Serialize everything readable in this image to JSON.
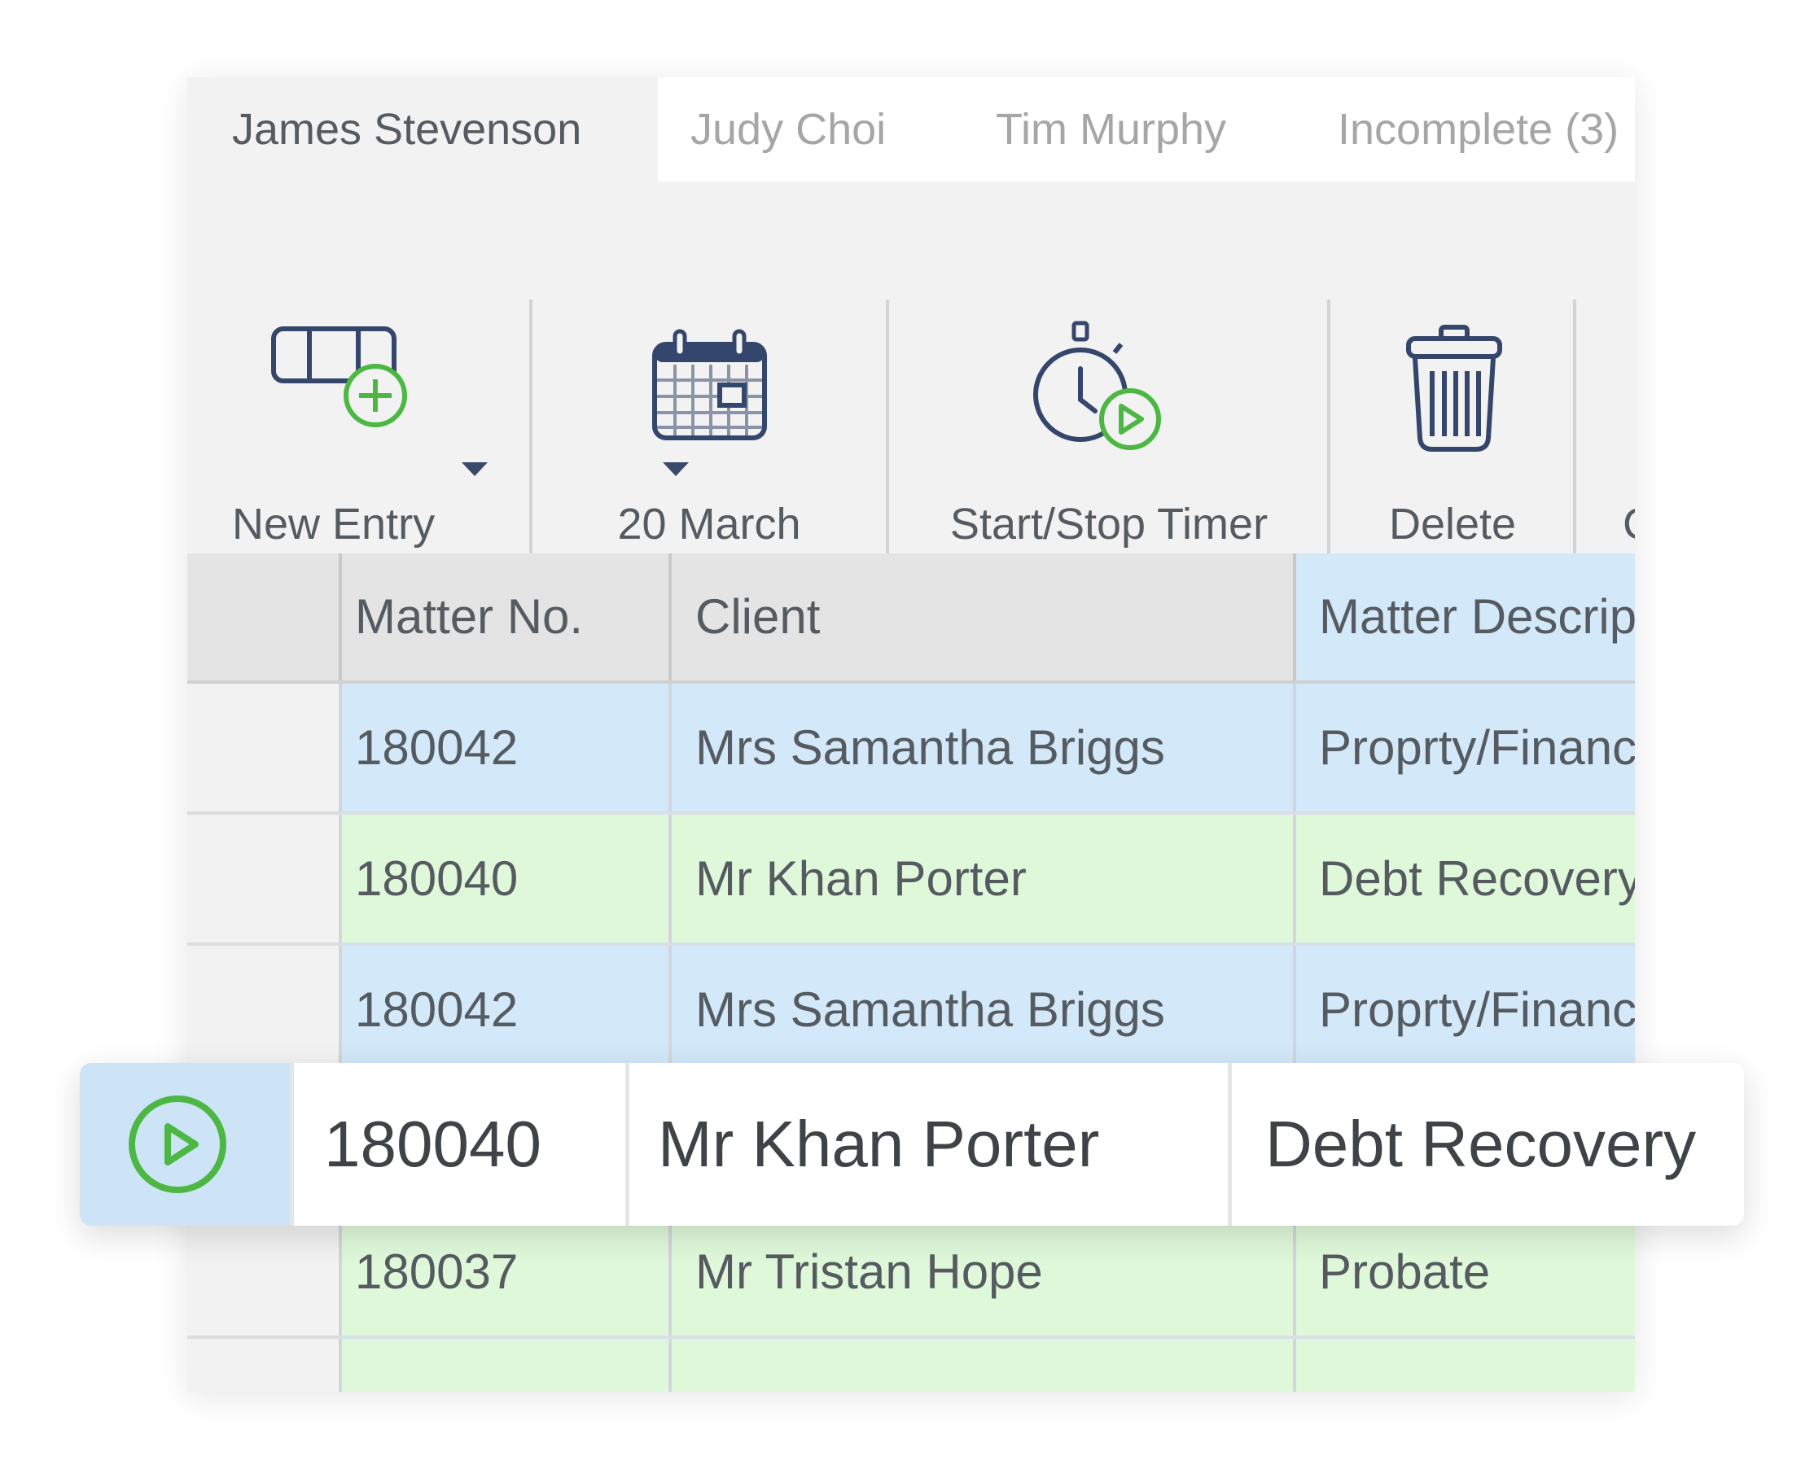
{
  "tabs": [
    {
      "label": "James Stevenson",
      "active": true
    },
    {
      "label": "Judy Choi",
      "active": false
    },
    {
      "label": "Tim Murphy",
      "active": false
    },
    {
      "label": "Incomplete (3)",
      "active": false
    }
  ],
  "toolbar": {
    "new_entry": {
      "label": "New Entry",
      "icon": "new-entry-icon",
      "has_dropdown": true
    },
    "date": {
      "label": "20 March",
      "icon": "calendar-icon",
      "has_dropdown": true
    },
    "timer": {
      "label": "Start/Stop Timer",
      "icon": "stopwatch-play-icon"
    },
    "delete": {
      "label": "Delete",
      "icon": "trash-icon"
    },
    "cut_off_label": "C"
  },
  "table": {
    "columns": [
      "Matter No.",
      "Client",
      "Matter Descrip"
    ],
    "rows": [
      {
        "matter_no": "180042",
        "client": "Mrs Samantha Briggs",
        "description": "Proprty/Financ",
        "color": "blue"
      },
      {
        "matter_no": "180040",
        "client": "Mr Khan Porter",
        "description": "Debt Recovery",
        "color": "green"
      },
      {
        "matter_no": "180042",
        "client": "Mrs Samantha Briggs",
        "description": "Proprty/Financ",
        "color": "blue"
      },
      {
        "matter_no": "",
        "client": "",
        "description": "",
        "color": "blue"
      },
      {
        "matter_no": "180037",
        "client": "Mr Tristan Hope",
        "description": "Probate",
        "color": "green"
      },
      {
        "matter_no": "",
        "client": "",
        "description": "",
        "color": "green"
      }
    ]
  },
  "floating_row": {
    "matter_no": "180040",
    "client": "Mr Khan Porter",
    "description": "Debt Recovery",
    "icon": "play-circle-icon"
  },
  "colors": {
    "accent_green": "#4cb843",
    "icon_navy": "#34466b",
    "row_blue": "#d3e8f8",
    "row_green": "#e0f8da",
    "header_grey": "#e4e4e4"
  }
}
